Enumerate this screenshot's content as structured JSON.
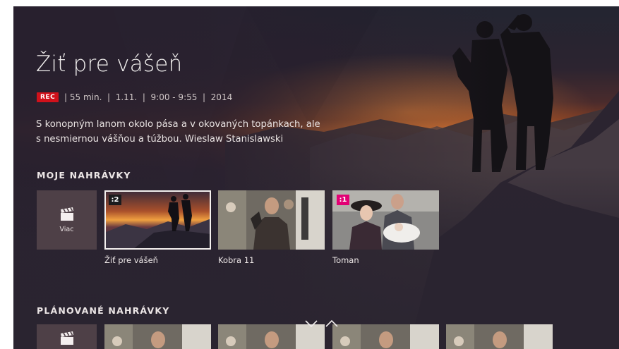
{
  "hero": {
    "title": "Žiť pre vášeň",
    "rec_badge": "REC",
    "meta": " | 55 min.  |  1.11.  |  9:00 - 9:55  |  2014",
    "description": "S konopným lanom okolo pása a v okovaných topánkach, ale s nesmiernou vášňou a túžbou. Wieslaw Stanislawski"
  },
  "my_recordings": {
    "heading": "MOJE NAHRÁVKY",
    "more_label": "Viac",
    "items": [
      {
        "caption": "Žiť pre vášeň",
        "badge": ":2",
        "selected": true
      },
      {
        "caption": "Kobra 11",
        "badge": "",
        "selected": false
      },
      {
        "caption": "Toman",
        "badge": ":1",
        "selected": false
      }
    ]
  },
  "planned_recordings": {
    "heading": "PLÁNOVANÉ NAHRÁVKY"
  },
  "colors": {
    "rec_red": "#d0111b",
    "brand_magenta": "#e20074",
    "panel": "#4e4047"
  },
  "icons": [
    "clapperboard-icon",
    "chevron-down-icon",
    "chevron-up-icon"
  ]
}
